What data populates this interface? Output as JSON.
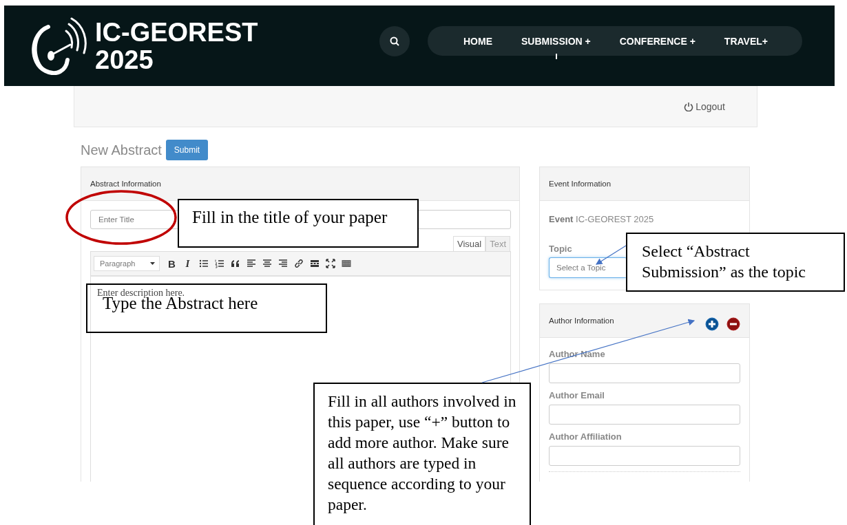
{
  "header": {
    "logo_line1": "IC-GEOREST",
    "logo_line2": "2025",
    "nav": [
      {
        "label": "HOME"
      },
      {
        "label": "SUBMISSION +"
      },
      {
        "label": "CONFERENCE +"
      },
      {
        "label": "TRAVEL+"
      }
    ]
  },
  "user_bar": {
    "logout": "Logout"
  },
  "page": {
    "title": "New Abstract",
    "submit": "Submit"
  },
  "abstract_panel": {
    "heading": "Abstract Information",
    "title_placeholder": "Enter Title",
    "editor_tabs": [
      {
        "label": "Visual",
        "selected": true
      },
      {
        "label": "Text",
        "selected": false
      }
    ],
    "format": "Paragraph",
    "text_buttons": [
      "B",
      "I"
    ],
    "description_placeholder": "Enter description here."
  },
  "event_panel": {
    "heading": "Event Information",
    "event_label": "Event",
    "event_value": "IC-GEOREST 2025",
    "topic_label": "Topic",
    "topic_placeholder": "Select a Topic"
  },
  "author_panel": {
    "heading": "Author Information",
    "fields": [
      {
        "label": "Author Name"
      },
      {
        "label": "Author Email"
      },
      {
        "label": "Author Affiliation"
      }
    ]
  },
  "annotations": [
    {
      "text": "Fill in the title of your paper"
    },
    {
      "text": "Select “Abstract Submission” as the topic"
    },
    {
      "text": "Type the Abstract here"
    },
    {
      "text": "Fill in all authors involved in this paper, use “+” button to add more author. Make sure all authors are typed in sequence according to your paper."
    }
  ]
}
